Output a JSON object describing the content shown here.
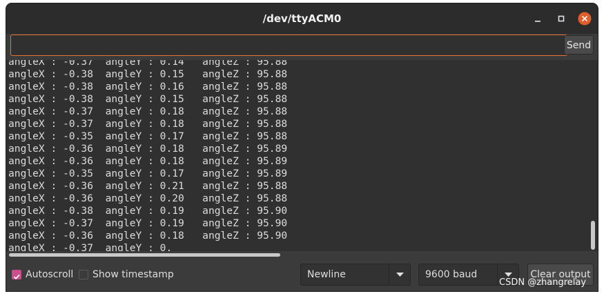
{
  "window": {
    "title": "/dev/ttyACM0",
    "accent": "#e2743a",
    "close_color": "#e05e2b"
  },
  "input": {
    "value": "",
    "placeholder": ""
  },
  "send_label": "Send",
  "output_lines": [
    "angleX : -0.37  angleY : 0.14   angleZ : 95.88",
    "angleX : -0.38  angleY : 0.15   angleZ : 95.88",
    "angleX : -0.38  angleY : 0.16   angleZ : 95.88",
    "angleX : -0.38  angleY : 0.15   angleZ : 95.88",
    "angleX : -0.37  angleY : 0.18   angleZ : 95.88",
    "angleX : -0.37  angleY : 0.18   angleZ : 95.88",
    "angleX : -0.35  angleY : 0.17   angleZ : 95.88",
    "angleX : -0.36  angleY : 0.18   angleZ : 95.89",
    "angleX : -0.36  angleY : 0.18   angleZ : 95.89",
    "angleX : -0.35  angleY : 0.17   angleZ : 95.89",
    "angleX : -0.36  angleY : 0.21   angleZ : 95.88",
    "angleX : -0.36  angleY : 0.20   angleZ : 95.88",
    "angleX : -0.38  angleY : 0.19   angleZ : 95.90",
    "angleX : -0.37  angleY : 0.19   angleZ : 95.90",
    "angleX : -0.36  angleY : 0.18   angleZ : 95.90",
    "angleX : -0.37  angleY : 0."
  ],
  "footer": {
    "autoscroll_label": "Autoscroll",
    "autoscroll_checked": true,
    "timestamp_label": "Show timestamp",
    "timestamp_checked": false,
    "line_ending": "Newline",
    "baud_rate": "9600 baud",
    "clear_label": "Clear output",
    "checkbox_color": "#c64f8c"
  },
  "watermark": "CSDN @zhangrelay"
}
